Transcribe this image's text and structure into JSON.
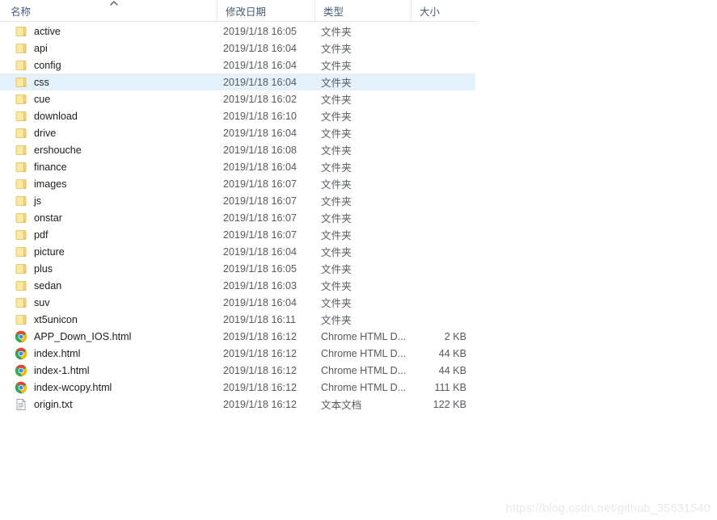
{
  "columns": {
    "name": "名称",
    "date_modified": "修改日期",
    "type": "类型",
    "size": "大小",
    "sort_indicator": "chevron-up"
  },
  "types": {
    "folder": "文件夹",
    "chrome_html": "Chrome HTML D...",
    "text_doc": "文本文档"
  },
  "rows": [
    {
      "name": "active",
      "date": "2019/1/18 16:05",
      "type": "文件夹",
      "size": "",
      "icon": "folder-icon",
      "selected": false
    },
    {
      "name": "api",
      "date": "2019/1/18 16:04",
      "type": "文件夹",
      "size": "",
      "icon": "folder-icon",
      "selected": false
    },
    {
      "name": "config",
      "date": "2019/1/18 16:04",
      "type": "文件夹",
      "size": "",
      "icon": "folder-icon",
      "selected": false
    },
    {
      "name": "css",
      "date": "2019/1/18 16:04",
      "type": "文件夹",
      "size": "",
      "icon": "folder-icon",
      "selected": true
    },
    {
      "name": "cue",
      "date": "2019/1/18 16:02",
      "type": "文件夹",
      "size": "",
      "icon": "folder-icon",
      "selected": false
    },
    {
      "name": "download",
      "date": "2019/1/18 16:10",
      "type": "文件夹",
      "size": "",
      "icon": "folder-icon",
      "selected": false
    },
    {
      "name": "drive",
      "date": "2019/1/18 16:04",
      "type": "文件夹",
      "size": "",
      "icon": "folder-icon",
      "selected": false
    },
    {
      "name": "ershouche",
      "date": "2019/1/18 16:08",
      "type": "文件夹",
      "size": "",
      "icon": "folder-icon",
      "selected": false
    },
    {
      "name": "finance",
      "date": "2019/1/18 16:04",
      "type": "文件夹",
      "size": "",
      "icon": "folder-icon",
      "selected": false
    },
    {
      "name": "images",
      "date": "2019/1/18 16:07",
      "type": "文件夹",
      "size": "",
      "icon": "folder-icon",
      "selected": false
    },
    {
      "name": "js",
      "date": "2019/1/18 16:07",
      "type": "文件夹",
      "size": "",
      "icon": "folder-icon",
      "selected": false
    },
    {
      "name": "onstar",
      "date": "2019/1/18 16:07",
      "type": "文件夹",
      "size": "",
      "icon": "folder-icon",
      "selected": false
    },
    {
      "name": "pdf",
      "date": "2019/1/18 16:07",
      "type": "文件夹",
      "size": "",
      "icon": "folder-icon",
      "selected": false
    },
    {
      "name": "picture",
      "date": "2019/1/18 16:04",
      "type": "文件夹",
      "size": "",
      "icon": "folder-icon",
      "selected": false
    },
    {
      "name": "plus",
      "date": "2019/1/18 16:05",
      "type": "文件夹",
      "size": "",
      "icon": "folder-icon",
      "selected": false
    },
    {
      "name": "sedan",
      "date": "2019/1/18 16:03",
      "type": "文件夹",
      "size": "",
      "icon": "folder-icon",
      "selected": false
    },
    {
      "name": "suv",
      "date": "2019/1/18 16:04",
      "type": "文件夹",
      "size": "",
      "icon": "folder-icon",
      "selected": false
    },
    {
      "name": "xt5unicon",
      "date": "2019/1/18 16:11",
      "type": "文件夹",
      "size": "",
      "icon": "folder-icon",
      "selected": false
    },
    {
      "name": "APP_Down_IOS.html",
      "date": "2019/1/18 16:12",
      "type": "Chrome HTML D...",
      "size": "2 KB",
      "icon": "chrome-icon",
      "selected": false
    },
    {
      "name": "index.html",
      "date": "2019/1/18 16:12",
      "type": "Chrome HTML D...",
      "size": "44 KB",
      "icon": "chrome-icon",
      "selected": false
    },
    {
      "name": "index-1.html",
      "date": "2019/1/18 16:12",
      "type": "Chrome HTML D...",
      "size": "44 KB",
      "icon": "chrome-icon",
      "selected": false
    },
    {
      "name": "index-wcopy.html",
      "date": "2019/1/18 16:12",
      "type": "Chrome HTML D...",
      "size": "111 KB",
      "icon": "chrome-icon",
      "selected": false
    },
    {
      "name": "origin.txt",
      "date": "2019/1/18 16:12",
      "type": "文本文档",
      "size": "122 KB",
      "icon": "text-document-icon",
      "selected": false
    }
  ],
  "watermark": "https://blog.csdn.net/github_35631540",
  "colors": {
    "selection": "#e5f1fb",
    "header_text": "#4a5a78",
    "folder": "#f5d97a",
    "chrome_red": "#ea4335",
    "chrome_yellow": "#fbbc05",
    "chrome_green": "#34a853",
    "chrome_blue": "#4285f4",
    "watermark": "#e7e9ec"
  }
}
